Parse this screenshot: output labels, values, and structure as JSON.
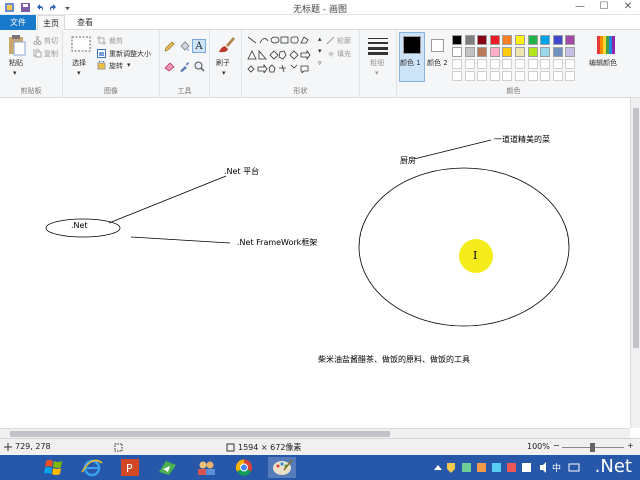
{
  "window": {
    "title": "无标题 - 画图",
    "controls": [
      "—",
      "☐",
      "✕"
    ]
  },
  "tabs": [
    {
      "label": "文件"
    },
    {
      "label": "主页"
    },
    {
      "label": "查看"
    }
  ],
  "ribbon": {
    "clipboard": {
      "group_label": "剪贴板",
      "paste": "粘贴",
      "cut": "剪切",
      "copy": "复制"
    },
    "image": {
      "group_label": "图像",
      "select": "选择",
      "crop": "裁剪",
      "resize": "重新调整大小",
      "rotate": "旋转"
    },
    "tools": {
      "group_label": "工具"
    },
    "brushes": {
      "label": "刷子"
    },
    "shapes": {
      "group_label": "形状",
      "outline": "轮廓",
      "fill": "填充"
    },
    "size": {
      "label": "粗细"
    },
    "colors": {
      "group_label": "颜色",
      "color1": "颜色 1",
      "color2": "颜色 2",
      "edit": "编辑颜色",
      "palette_row1": [
        "#000000",
        "#7f7f7f",
        "#880015",
        "#ed1c24",
        "#ff7f27",
        "#fff200",
        "#22b14c",
        "#00a2e8",
        "#3f48cc",
        "#a349a4"
      ],
      "palette_row2": [
        "#ffffff",
        "#c3c3c3",
        "#b97a57",
        "#ffaec9",
        "#ffc90e",
        "#efe4b0",
        "#b5e61d",
        "#99d9ea",
        "#7092be",
        "#c8bfe7"
      ]
    }
  },
  "canvas": {
    "texts": {
      "net": ".Net",
      "platform": ".Net 平台",
      "framework": ".Net FrameWork框架",
      "kitchen": "厨房",
      "dish": "一道道精美的菜",
      "ingredients": "柴米油盐酱醋茶、做饭的原料、做饭的工具",
      "cursor": "I"
    }
  },
  "status": {
    "position": "729, 278",
    "size": "1594 × 672像素",
    "zoom": "100%",
    "zoom_minus": "−",
    "zoom_plus": "+"
  },
  "taskbar": {
    "brand": ".Net"
  }
}
